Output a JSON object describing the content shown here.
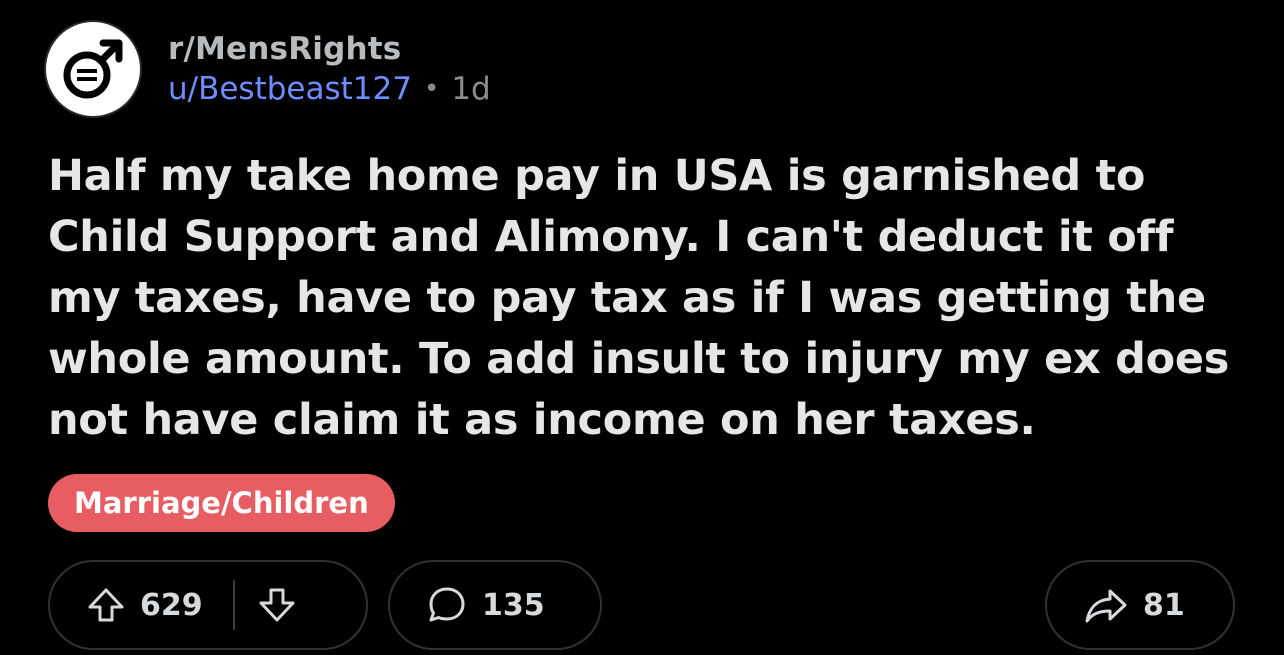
{
  "post": {
    "subreddit": "r/MensRights",
    "username": "u/Bestbeast127",
    "separator": "•",
    "age": "1d",
    "title": "Half my take home pay in USA is garnished to Child Support and Alimony. I can't deduct it off my taxes, have to pay tax as if I was getting the whole amount. To add insult to injury my ex does not have claim it as income on her taxes.",
    "flair": "Marriage/Children"
  },
  "actions": {
    "upvotes": "629",
    "comments": "135",
    "shares": "81"
  },
  "colors": {
    "background": "#000000",
    "username": "#6f8dff",
    "flair_background": "#e85d62",
    "text": "#e4e6e8"
  },
  "icons": {
    "avatar": "male-symbol-icon",
    "upvote": "arrow-up-icon",
    "downvote": "arrow-down-icon",
    "comment": "speech-bubble-icon",
    "share": "share-arrow-icon"
  }
}
